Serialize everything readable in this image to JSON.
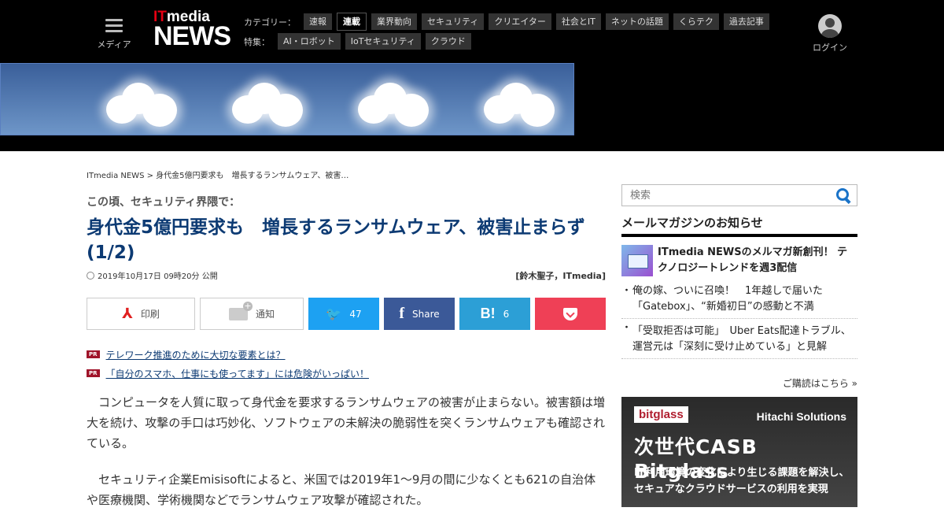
{
  "header": {
    "menu_label": "メディア",
    "logo_it_red": "IT",
    "logo_it_white": "media",
    "logo_news": "NEWS",
    "nav_label_category": "カテゴリー：",
    "nav_label_feature": "特集：",
    "categories": [
      "速報",
      "連載",
      "業界動向",
      "セキュリティ",
      "クリエイター",
      "社会とIT",
      "ネットの話題",
      "くらテク",
      "過去記事"
    ],
    "features": [
      "AI・ロボット",
      "IoTセキュリティ",
      "クラウド"
    ],
    "login_label": "ログイン"
  },
  "breadcrumb": "ITmedia NEWS > 身代金5億円要求も　増長するランサムウェア、被害…",
  "article": {
    "kicker": "この頃、セキュリティ界隈で：",
    "title": "身代金5億円要求も　増長するランサムウェア、被害止まらず (1/2)",
    "date": "2019年10月17日 09時20分 公開",
    "author": "[鈴木聖子，ITmedia]",
    "paragraphs": [
      "コンピュータを人質に取って身代金を要求するランサムウェアの被害が止まらない。被害額は増大を続け、攻撃の手口は巧妙化、ソフトウェアの未解決の脆弱性を突くランサムウェアも確認されている。",
      "セキュリティ企業Emisisoftによると、米国では2019年1～9月の間に少なくとも621の自治体や医療機関、学術機関などでランサムウェア攻撃が確認された。"
    ]
  },
  "share": {
    "print_label": "印刷",
    "notify_label": "通知",
    "twitter_count": "47",
    "facebook_label": "Share",
    "hatena_count": "6",
    "hatena_icon_text": "B!"
  },
  "pr": {
    "badge": "PR",
    "links": [
      "テレワーク推進のために大切な要素とは？",
      "「自分のスマホ、仕事にも使ってます」には危険がいっぱい！"
    ]
  },
  "sidebar": {
    "search_placeholder": "検索",
    "mm_heading": "メールマガジンのお知らせ",
    "mm_feature": "ITmedia NEWSのメルマガ新創刊！ テクノロジートレンドを週3配信",
    "mm_items": [
      "俺の嫁、ついに召喚！　1年越しで届いた「Gatebox」、“新婚初日”の感動と不満",
      "「受取拒否は可能」　Uber Eats配達トラブル、運営元は「深刻に受け止めている」と見解"
    ],
    "mm_more": "ご購読はこちら »"
  },
  "ad": {
    "logo": "bitglass",
    "company": "Hitachi Solutions",
    "title": "次世代CASB Bitglass",
    "desc_line1": "IT利用環境の変化により生じる課題を解決し、",
    "desc_line2": "セキュアなクラウドサービスの利用を実現"
  },
  "colors": {
    "header_bg": "#000000",
    "title_blue": "#0c3a73",
    "twitter": "#1da1f2",
    "facebook": "#3b5998",
    "hatena": "#2c9fd6",
    "pocket": "#ef4056",
    "pr_badge": "#a0142a"
  }
}
